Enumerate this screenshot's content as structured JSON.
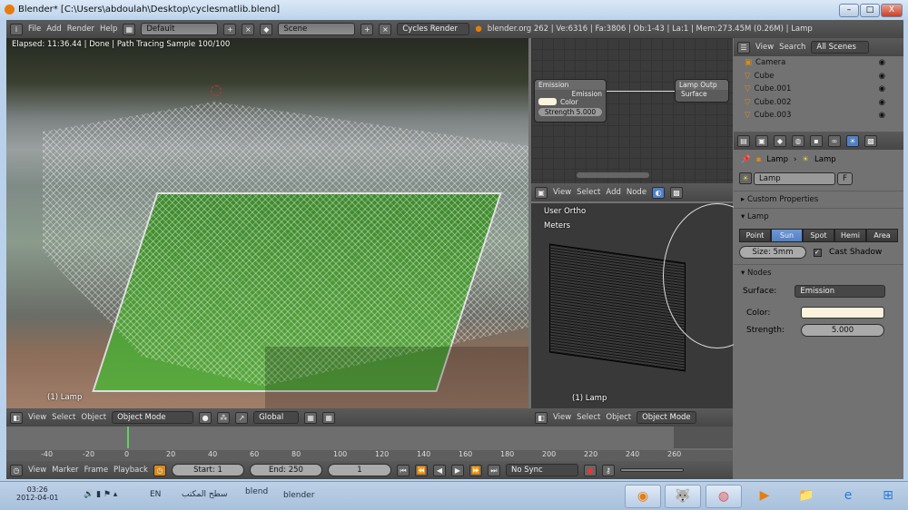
{
  "window": {
    "title": "Blender* [C:\\Users\\abdoulah\\Desktop\\cyclesmatlib.blend]",
    "minimize": "–",
    "maximize": "□",
    "close": "X"
  },
  "info_header": {
    "menus": [
      "File",
      "Add",
      "Render",
      "Help"
    ],
    "layout": "Default",
    "scene": "Scene",
    "engine": "Cycles Render",
    "stats": "blender.org 262 | Ve:6316 | Fa:3806 | Ob:1-43 | La:1 | Mem:273.45M (0.26M) | Lamp"
  },
  "render_view": {
    "status": "Elapsed: 11:36.44 | Done | Path Tracing Sample 100/100",
    "object_label": "(1) Lamp"
  },
  "node_editor": {
    "emission_node": {
      "title": "Emission",
      "output": "Emission",
      "color_label": "Color",
      "strength": "Strength 5.000"
    },
    "output_node": {
      "title": "Lamp Outp",
      "input": "Surface"
    },
    "menus": [
      "View",
      "Select",
      "Add",
      "Node"
    ]
  },
  "viewport3d": {
    "view_name": "User Ortho",
    "units": "Meters",
    "object_label": "(1) Lamp",
    "menus": [
      "View",
      "Select",
      "Object"
    ],
    "mode": "Object Mode"
  },
  "left_header": {
    "menus": [
      "View",
      "Select",
      "Object"
    ],
    "mode": "Object Mode",
    "orientation": "Global"
  },
  "outliner": {
    "menus": [
      "View",
      "Search"
    ],
    "filter": "All Scenes",
    "items": [
      "Camera",
      "Cube",
      "Cube.001",
      "Cube.002",
      "Cube.003"
    ]
  },
  "properties": {
    "breadcrumb": [
      "Lamp",
      "Lamp"
    ],
    "datablock": "Lamp",
    "fake_user": "F",
    "custom_properties": "Custom Properties",
    "lamp_section": "Lamp",
    "lamp_types": [
      "Point",
      "Sun",
      "Spot",
      "Hemi",
      "Area"
    ],
    "active_type": "Sun",
    "size": "Size: 5mm",
    "cast_shadow": "Cast Shadow",
    "nodes_section": "Nodes",
    "surface_label": "Surface:",
    "surface_value": "Emission",
    "color_label": "Color:",
    "color_value": "#fbf3dc",
    "strength_label": "Strength:",
    "strength_value": "5.000"
  },
  "timeline": {
    "ticks": [
      "-40",
      "-20",
      "0",
      "20",
      "40",
      "60",
      "80",
      "100",
      "120",
      "140",
      "160",
      "180",
      "200",
      "220",
      "240",
      "260"
    ],
    "menus": [
      "View",
      "Marker",
      "Frame",
      "Playback"
    ],
    "start": "Start: 1",
    "end": "End: 250",
    "current": "1",
    "sync": "No Sync"
  },
  "taskbar": {
    "time": "03:26",
    "date": "2012-04-01",
    "lang": "EN",
    "desktop": "سطح المكتب",
    "folder1": "blend",
    "folder2": "blender"
  }
}
